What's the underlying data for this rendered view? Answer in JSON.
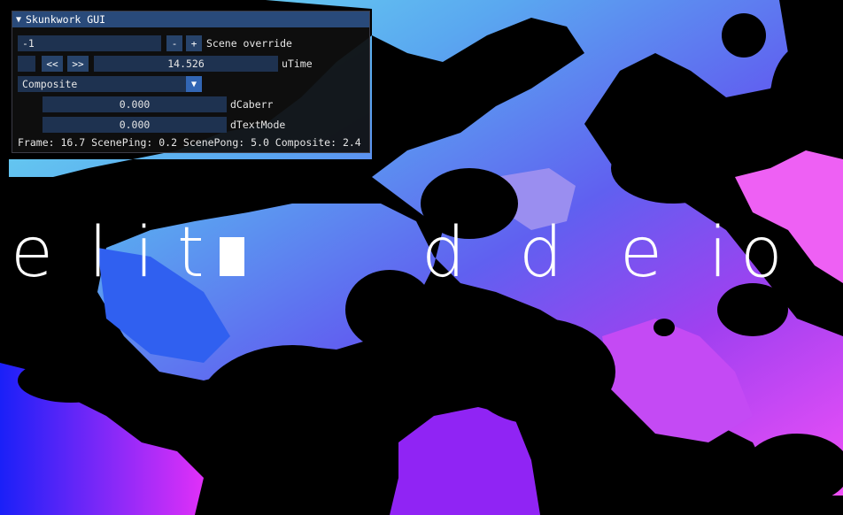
{
  "window": {
    "title": "Skunkwork GUI",
    "collapse_icon": "triangle-down-icon"
  },
  "scene_override": {
    "value": "-1",
    "minus_label": "-",
    "plus_label": "+",
    "label": "Scene override"
  },
  "utime": {
    "rewind_label": "<<",
    "forward_label": ">>",
    "value": "14.526",
    "label": "uTime"
  },
  "pass_select": {
    "selected": "Composite",
    "arrow_icon": "triangle-down-icon"
  },
  "dcaberr": {
    "value": "0.000",
    "label": "dCaberr"
  },
  "dtextmode": {
    "value": "0.000",
    "label": "dTextMode"
  },
  "stats": {
    "text": "Frame: 16.7 ScenePing: 0.2 ScenePong: 5.0 Composite: 2.4"
  },
  "render": {
    "glyph_text": "eli d d e io",
    "colors": {
      "cyan": "#8af4ee",
      "sky": "#4aa4f0",
      "blue": "#1a20f8",
      "purple": "#8420f0",
      "pink": "#ff60f0",
      "magenta": "#e830f8"
    }
  }
}
